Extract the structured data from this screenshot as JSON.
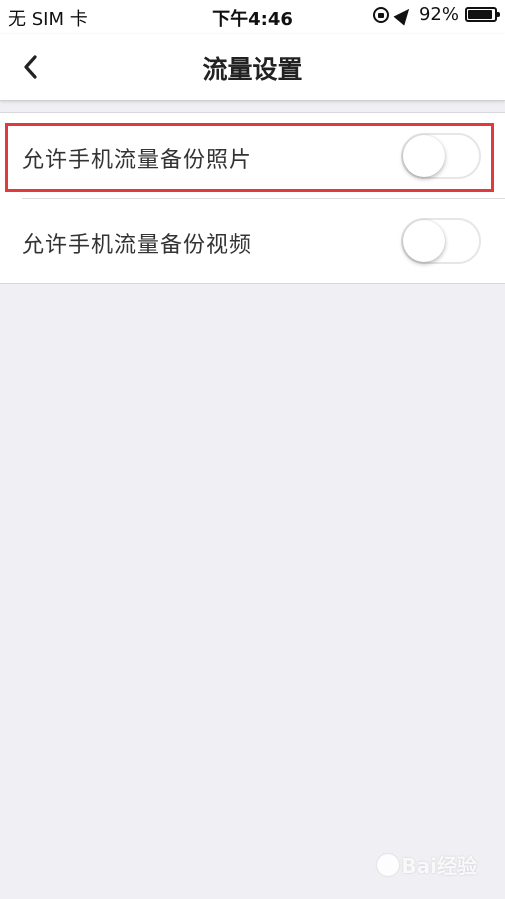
{
  "status_bar": {
    "carrier": "无 SIM 卡",
    "time": "下午4:46",
    "battery_percent": "92%",
    "battery_level": 0.92,
    "icons": [
      "rotation-lock-icon",
      "location-arrow-icon",
      "battery-icon"
    ]
  },
  "nav": {
    "title": "流量设置",
    "back_icon": "chevron-left-icon"
  },
  "settings": [
    {
      "label": "允许手机流量备份照片",
      "enabled": false,
      "highlighted": true
    },
    {
      "label": "允许手机流量备份视频",
      "enabled": false,
      "highlighted": false
    }
  ],
  "colors": {
    "background": "#efeff4",
    "highlight": "#e0393e",
    "switch_off_border": "#e6e6e9"
  },
  "watermark": {
    "text": "Bai经验",
    "logo": "baidu-paw-icon"
  }
}
